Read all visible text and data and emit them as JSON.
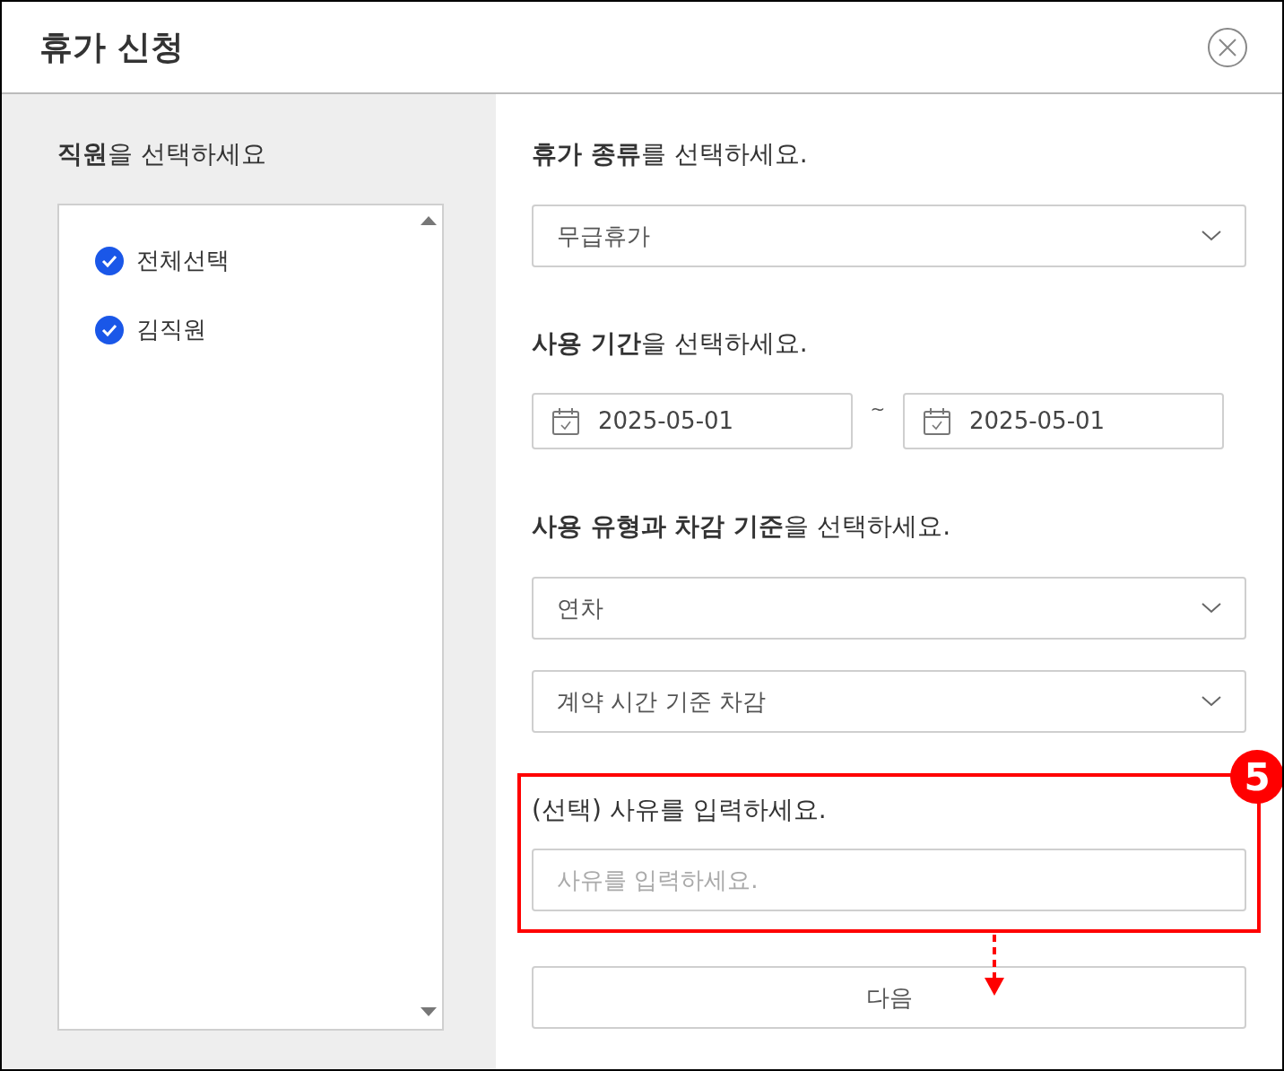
{
  "dialog": {
    "title": "휴가 신청"
  },
  "employees": {
    "heading": "**직원**을 선택하세요",
    "items": [
      {
        "label": "전체선택",
        "checked": true
      },
      {
        "label": "김직원",
        "checked": true
      }
    ]
  },
  "leave_type": {
    "heading": "**휴가 종류**를 선택하세요.",
    "value": "무급휴가"
  },
  "period": {
    "heading": "**사용 기간**을 선택하세요.",
    "start": "2025-05-01",
    "separator": "~",
    "end": "2025-05-01"
  },
  "usage": {
    "heading": "**사용 유형과 차감 기준**을 선택하세요.",
    "selects": [
      {
        "value": "연차"
      },
      {
        "value": "계약 시간 기준 차감"
      }
    ]
  },
  "reason": {
    "heading": "(선택) 사유를 입력하세요.",
    "placeholder": "사유를 입력하세요."
  },
  "next_button": "다음",
  "annotation": {
    "badge": "5"
  }
}
